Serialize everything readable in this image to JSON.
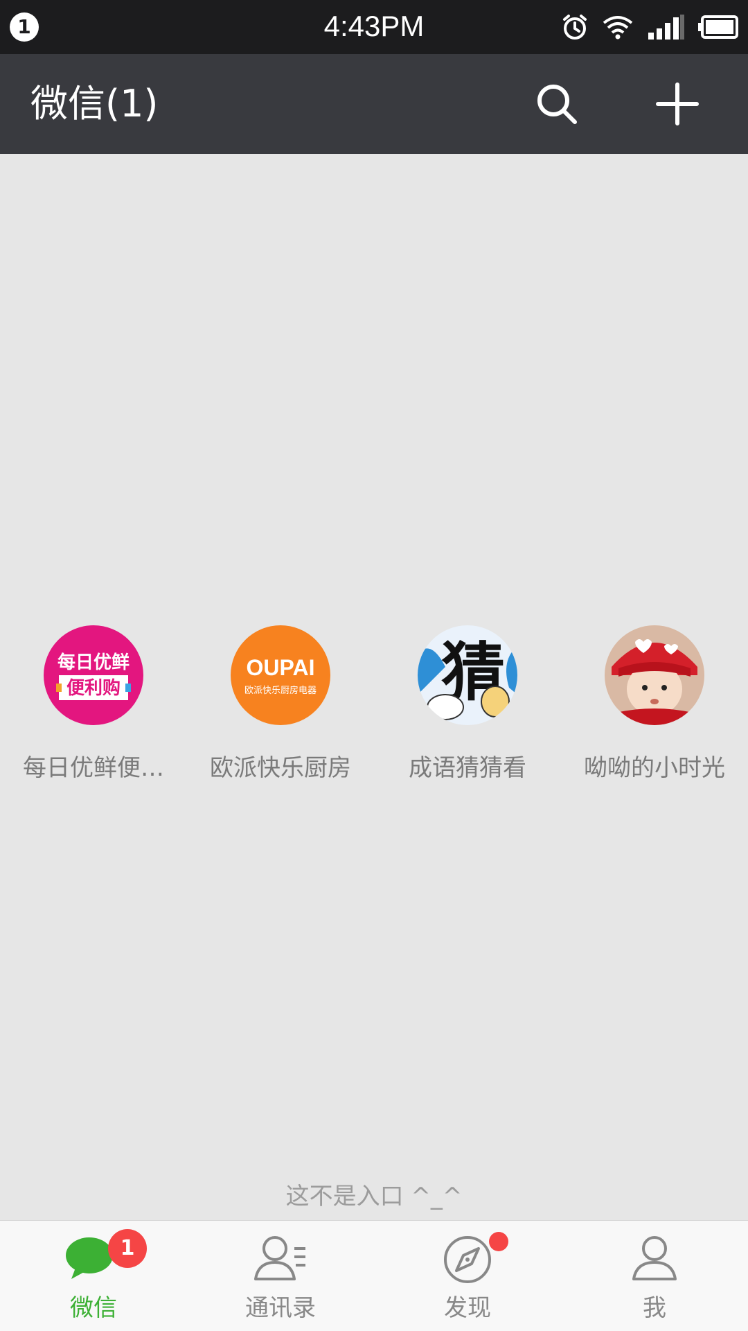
{
  "status_bar": {
    "notification_count": "1",
    "time": "4:43PM",
    "icons": [
      "alarm-icon",
      "wifi-icon",
      "signal-icon",
      "battery-icon"
    ]
  },
  "app_bar": {
    "title": "微信(1)",
    "actions": [
      "search-icon",
      "plus-icon"
    ]
  },
  "mini_programs": [
    {
      "label": "每日优鲜便…",
      "avatar_text_top": "每日优鲜",
      "avatar_text_bottom": "便利购",
      "color": "#e3167f"
    },
    {
      "label": "欧派快乐厨房",
      "avatar_text_top": "OUPAI",
      "avatar_text_bottom": "欧派快乐厨房电器",
      "color": "#f7821f"
    },
    {
      "label": "成语猜猜看",
      "avatar_text_top": "猜",
      "color": "#eaf2fb"
    },
    {
      "label": "呦呦的小时光",
      "color": "#ecd9cd"
    }
  ],
  "hint": "这不是入口 ^_^",
  "tab_bar": {
    "accent_color": "#3cb034",
    "tabs": [
      {
        "label": "微信",
        "badge": "1",
        "active": true
      },
      {
        "label": "通讯录"
      },
      {
        "label": "发现",
        "dot": true
      },
      {
        "label": "我"
      }
    ]
  }
}
